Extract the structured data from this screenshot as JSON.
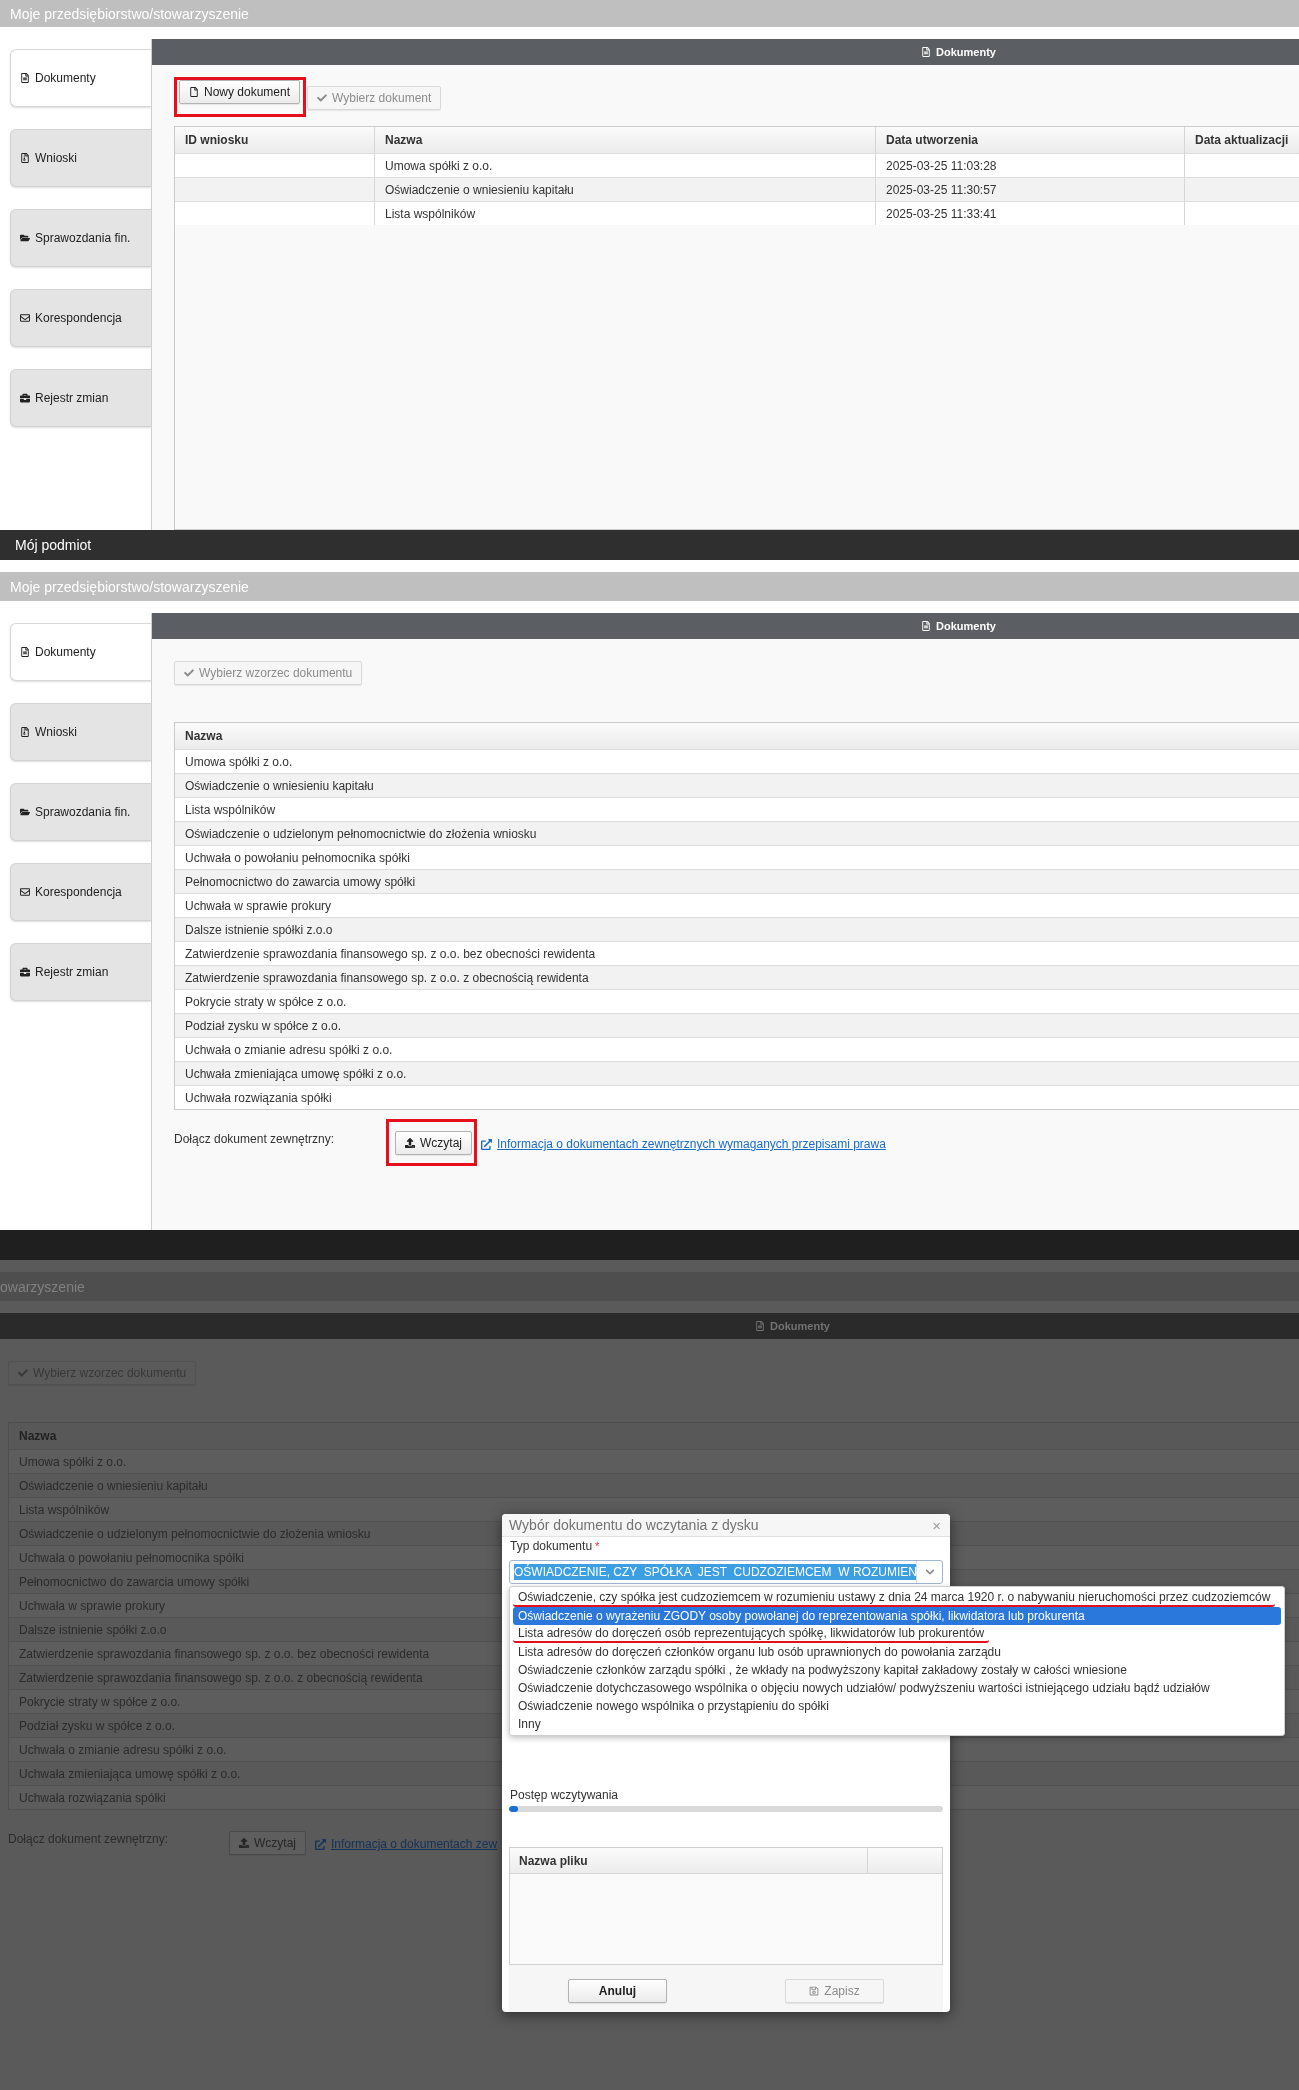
{
  "screen_1": {
    "page_title": "Moje przedsiębiorstwo/stowarzyszenie",
    "sidebar": {
      "items": [
        {
          "label": "Dokumenty",
          "selected": true
        },
        {
          "label": "Wnioski",
          "selected": false
        },
        {
          "label": "Sprawozdania fin.",
          "selected": false
        },
        {
          "label": "Korespondencja",
          "selected": false
        },
        {
          "label": "Rejestr zmian",
          "selected": false
        }
      ]
    },
    "panel": {
      "title": "Dokumenty",
      "toolbar": [
        {
          "label": "Nowy dokument",
          "kind": "new",
          "disabled": false,
          "highlighted": true
        },
        {
          "label": "Wybierz dokument",
          "kind": "select",
          "disabled": true,
          "highlighted": false
        }
      ],
      "table": {
        "columns": [
          "ID wniosku",
          "Nazwa",
          "Data utworzenia",
          "Data aktualizacji"
        ],
        "rows": [
          {
            "name": "Umowa spółki z o.o.",
            "created": "2025-03-25 11:03:28"
          },
          {
            "name": "Oświadczenie o wniesieniu kapitału",
            "created": "2025-03-25 11:30:57"
          },
          {
            "name": "Lista wspólników",
            "created": "2025-03-25 11:33:41"
          }
        ]
      }
    }
  },
  "screen_2": {
    "top_bar": {
      "title": "Mój podmiot"
    },
    "page_title": "Moje przedsiębiorstwo/stowarzyszenie",
    "sidebar": {
      "items": [
        {
          "label": "Dokumenty",
          "selected": true
        },
        {
          "label": "Wnioski",
          "selected": false
        },
        {
          "label": "Sprawozdania fin.",
          "selected": false
        },
        {
          "label": "Korespondencja",
          "selected": false
        },
        {
          "label": "Rejestr zmian",
          "selected": false
        }
      ]
    },
    "panel": {
      "title": "Dokumenty",
      "toolbar": [
        {
          "label": "Wybierz wzorzec dokumentu",
          "kind": "select",
          "disabled": true,
          "highlighted": false
        }
      ],
      "table": {
        "columns": [
          "Nazwa"
        ],
        "rows": [
          {
            "name": "Umowa spółki z o.o."
          },
          {
            "name": "Oświadczenie o wniesieniu kapitału"
          },
          {
            "name": "Lista wspólników"
          },
          {
            "name": "Oświadczenie o udzielonym pełnomocnictwie do złożenia wniosku"
          },
          {
            "name": "Uchwała o powołaniu pełnomocnika spółki"
          },
          {
            "name": "Pełnomocnictwo do zawarcia umowy spółki"
          },
          {
            "name": "Uchwała w sprawie prokury"
          },
          {
            "name": "Dalsze istnienie spółki z.o.o"
          },
          {
            "name": "Zatwierdzenie sprawozdania finansowego sp. z o.o. bez obecności rewidenta"
          },
          {
            "name": "Zatwierdzenie sprawozdania finansowego sp. z o.o. z obecnością rewidenta"
          },
          {
            "name": "Pokrycie straty w spółce z o.o."
          },
          {
            "name": "Podział zysku w spółce z o.o."
          },
          {
            "name": "Uchwała o zmianie adresu spółki z o.o."
          },
          {
            "name": "Uchwała zmieniająca umowę spółki z o.o."
          },
          {
            "name": "Uchwała rozwiązania spółki"
          }
        ]
      },
      "attach": {
        "label": "Dołącz dokument zewnętrzny:",
        "button": {
          "label": "Wczytaj",
          "kind": "upload",
          "disabled": false,
          "highlighted": true
        },
        "link": "Informacja o dokumentach zewnętrznych wymaganych przepisami prawa"
      }
    }
  },
  "screen_3": {
    "dimmed": true,
    "top_bar": {
      "visible": true
    },
    "page_title": "owarzyszenie",
    "panel": {
      "title": "Dokumenty",
      "toolbar": [
        {
          "label": "Wybierz wzorzec dokumentu",
          "kind": "select",
          "disabled": true,
          "highlighted": false
        }
      ],
      "table": {
        "columns": [
          "Nazwa"
        ],
        "rows": [
          {
            "name": "Umowa spółki z o.o."
          },
          {
            "name": "Oświadczenie o wniesieniu kapitału"
          },
          {
            "name": "Lista wspólników"
          },
          {
            "name": "Oświadczenie o udzielonym pełnomocnictwie do złożenia wniosku"
          },
          {
            "name": "Uchwała o powołaniu pełnomocnika spółki"
          },
          {
            "name": "Pełnomocnictwo do zawarcia umowy spółki"
          },
          {
            "name": "Uchwała w sprawie prokury"
          },
          {
            "name": "Dalsze istnienie spółki z.o.o"
          },
          {
            "name": "Zatwierdzenie sprawozdania finansowego sp. z o.o. bez obecności rewidenta"
          },
          {
            "name": "Zatwierdzenie sprawozdania finansowego sp. z o.o. z obecnością rewidenta"
          },
          {
            "name": "Pokrycie straty w spółce z o.o."
          },
          {
            "name": "Podział zysku w spółce z o.o."
          },
          {
            "name": "Uchwała o zmianie adresu spółki z o.o."
          },
          {
            "name": "Uchwała zmieniająca umowę spółki z o.o."
          },
          {
            "name": "Uchwała rozwiązania spółki"
          }
        ]
      },
      "attach": {
        "label": "Dołącz dokument zewnętrzny:",
        "button": {
          "label": "Wczytaj",
          "kind": "upload",
          "disabled": false,
          "highlighted": false
        },
        "link": "Informacja o dokumentach zew"
      }
    },
    "dialog": {
      "title": "Wybór dokumentu do wczytania z dysku",
      "close": "×",
      "type_field": {
        "label": "Typ dokumentu",
        "required_mark": "*",
        "value": "OŚWIADCZENIE, CZY  SPÓŁKA  JEST  CUDZOZIEMCEM  W ROZUMIEN",
        "expanded": true
      },
      "options": [
        {
          "label": "Oświadczenie, czy spółka jest cudzoziemcem w rozumieniu ustawy z dnia 24 marca 1920 r. o nabywaniu nieruchomości przez cudzoziemców",
          "selected": false,
          "underlined": true
        },
        {
          "label": "Oświadczenie o wyrażeniu ZGODY osoby powołanej do reprezentowania spółki, likwidatora lub prokurenta",
          "selected": true,
          "underlined": false
        },
        {
          "label": "Lista adresów do doręczeń osób reprezentujących spółkę, likwidatorów lub prokurentów",
          "selected": false,
          "underlined": true
        },
        {
          "label": "Lista adresów do doręczeń członków organu lub osób uprawnionych do powołania zarządu",
          "selected": false,
          "underlined": false
        },
        {
          "label": "Oświadczenie członków zarządu spółki , że wkłady na podwyższony kapitał zakładowy zostały w całości wniesione",
          "selected": false,
          "underlined": false
        },
        {
          "label": "Oświadczenie dotychczasowego wspólnika o objęciu nowych udziałów/ podwyższeniu wartości istniejącego udziału bądź udziałów",
          "selected": false,
          "underlined": false
        },
        {
          "label": "Oświadczenie nowego wspólnika o przystąpieniu do spółki",
          "selected": false,
          "underlined": false
        },
        {
          "label": "Inny",
          "selected": false,
          "underlined": false
        }
      ],
      "progress": {
        "label": "Postęp wczytywania",
        "level": 0.02
      },
      "files_table": {
        "columns": [
          "Nazwa pliku"
        ]
      },
      "buttons": [
        {
          "label": "Anuluj",
          "kind": "cancel",
          "disabled": false
        },
        {
          "label": "Zapisz",
          "kind": "save",
          "disabled": true
        }
      ]
    }
  }
}
